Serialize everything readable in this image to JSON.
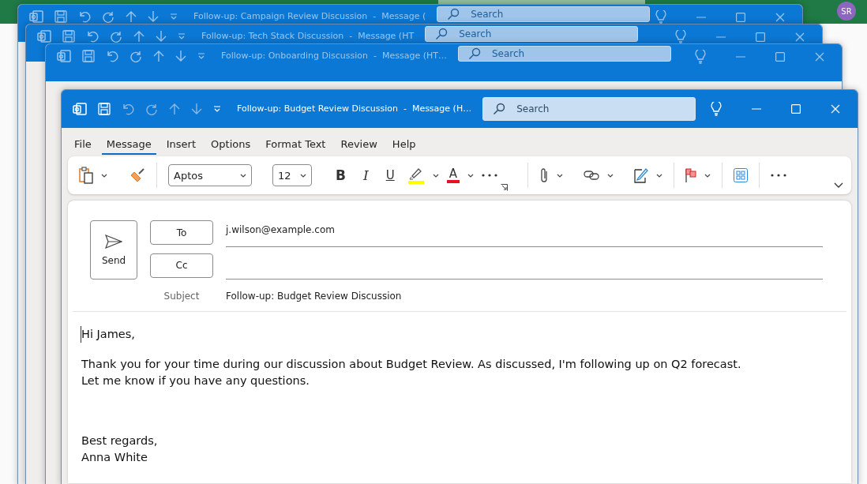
{
  "background_app": {
    "avatar": "SR"
  },
  "back_windows": [
    {
      "title": "Follow-up: Campaign Review Discussion  -  Message (",
      "search_placeholder": "Search"
    },
    {
      "title": "Follow-up: Tech Stack Discussion  -  Message (HT",
      "search_placeholder": "Search"
    },
    {
      "title": "Follow-up: Onboarding Discussion  -  Message (HT…",
      "search_placeholder": "Search"
    }
  ],
  "active_window": {
    "title": "Follow-up: Budget Review Discussion  -  Message (H…",
    "search_placeholder": "Search",
    "menu_tabs": [
      {
        "label": "File",
        "selected": false
      },
      {
        "label": "Message",
        "selected": true
      },
      {
        "label": "Insert",
        "selected": false
      },
      {
        "label": "Options",
        "selected": false
      },
      {
        "label": "Format Text",
        "selected": false
      },
      {
        "label": "Review",
        "selected": false
      },
      {
        "label": "Help",
        "selected": false
      }
    ],
    "ribbon": {
      "font": "Aptos",
      "size": "12",
      "bold": "B",
      "italic": "I",
      "underline": "U",
      "font_color": "A"
    },
    "send": "Send",
    "to_button": "To",
    "to_value": "j.wilson@example.com",
    "cc_button": "Cc",
    "subject_label": "Subject",
    "subject_value": "Follow-up: Budget Review Discussion",
    "body": [
      {
        "lines": [
          "Hi James,"
        ]
      },
      {
        "lines": [
          "Thank you for your time during our discussion about Budget Review. As discussed, I'm following up on Q2 forecast.",
          "Let me know if you have any questions."
        ]
      },
      {
        "lines": [
          "Best regards,",
          "Anna White"
        ]
      }
    ]
  }
}
